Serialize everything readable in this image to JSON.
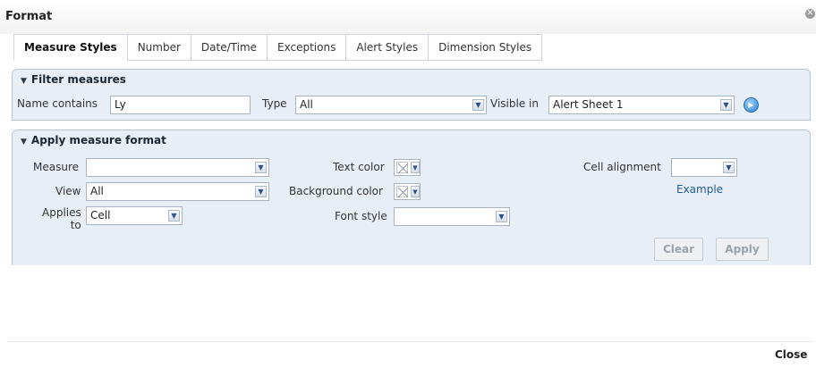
{
  "dialog": {
    "title": "Format",
    "close_label": "Close"
  },
  "tabs": [
    {
      "label": "Measure Styles"
    },
    {
      "label": "Number"
    },
    {
      "label": "Date/Time"
    },
    {
      "label": "Exceptions"
    },
    {
      "label": "Alert Styles"
    },
    {
      "label": "Dimension Styles"
    }
  ],
  "filter": {
    "header": "Filter measures",
    "name_label": "Name contains",
    "name_value": "Ly",
    "type_label": "Type",
    "type_value": "All",
    "visible_label": "Visible in",
    "visible_value": "Alert Sheet 1"
  },
  "format": {
    "header": "Apply measure format",
    "measure_label": "Measure",
    "measure_value": "",
    "view_label": "View",
    "view_value": "All",
    "applies_label_1": "Applies",
    "applies_label_2": "to",
    "applies_value": "Cell",
    "text_color_label": "Text color",
    "bg_color_label": "Background color",
    "font_style_label": "Font style",
    "font_style_value": "",
    "cell_alignment_label": "Cell alignment",
    "cell_alignment_value": "",
    "example_link": "Example",
    "clear_label": "Clear",
    "apply_label": "Apply"
  },
  "colors": {
    "panel_bg": "#e8eef6",
    "link": "#1f5a9a",
    "go_button": "#2f7fd0"
  }
}
